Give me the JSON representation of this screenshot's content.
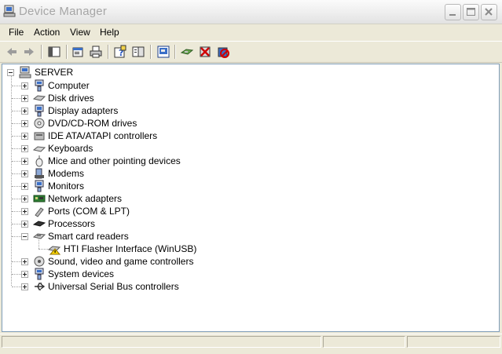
{
  "window": {
    "title": "Device Manager"
  },
  "titlebar_buttons": [
    "minimize-button",
    "maximize-button",
    "close-button"
  ],
  "menu": [
    "File",
    "Action",
    "View",
    "Help"
  ],
  "toolbar": {
    "items": [
      "back-icon",
      "forward-icon",
      "show-hide-console-tree-icon",
      "properties-icon",
      "print-icon",
      "help-icon",
      "export-list-icon",
      "scan-hardware-icon",
      "update-driver-icon",
      "uninstall-icon",
      "disable-icon"
    ]
  },
  "tree": {
    "root": "SERVER",
    "categories": [
      {
        "label": "Computer",
        "icon": "computer-icon",
        "expanded": false
      },
      {
        "label": "Disk drives",
        "icon": "disk-drive-icon",
        "expanded": false
      },
      {
        "label": "Display adapters",
        "icon": "display-adapter-icon",
        "expanded": false
      },
      {
        "label": "DVD/CD-ROM drives",
        "icon": "dvd-drive-icon",
        "expanded": false
      },
      {
        "label": "IDE ATA/ATAPI controllers",
        "icon": "ide-controller-icon",
        "expanded": false
      },
      {
        "label": "Keyboards",
        "icon": "keyboard-icon",
        "expanded": false
      },
      {
        "label": "Mice and other pointing devices",
        "icon": "mouse-icon",
        "expanded": false
      },
      {
        "label": "Modems",
        "icon": "modem-icon",
        "expanded": false
      },
      {
        "label": "Monitors",
        "icon": "monitor-icon",
        "expanded": false
      },
      {
        "label": "Network adapters",
        "icon": "network-adapter-icon",
        "expanded": false
      },
      {
        "label": "Ports (COM & LPT)",
        "icon": "port-icon",
        "expanded": false
      },
      {
        "label": "Processors",
        "icon": "processor-icon",
        "expanded": false
      },
      {
        "label": "Smart card readers",
        "icon": "smart-card-reader-icon",
        "expanded": true,
        "children": [
          {
            "label": "HTI Flasher Interface (WinUSB)",
            "icon": "warning-device-icon"
          }
        ]
      },
      {
        "label": "Sound, video and game controllers",
        "icon": "sound-icon",
        "expanded": false
      },
      {
        "label": "System devices",
        "icon": "system-device-icon",
        "expanded": false
      },
      {
        "label": "Universal Serial Bus controllers",
        "icon": "usb-icon",
        "expanded": false
      }
    ]
  },
  "colors": {
    "accent": "#316ac5",
    "warning": "#ffd700",
    "tree_border": "#7f9db9"
  }
}
